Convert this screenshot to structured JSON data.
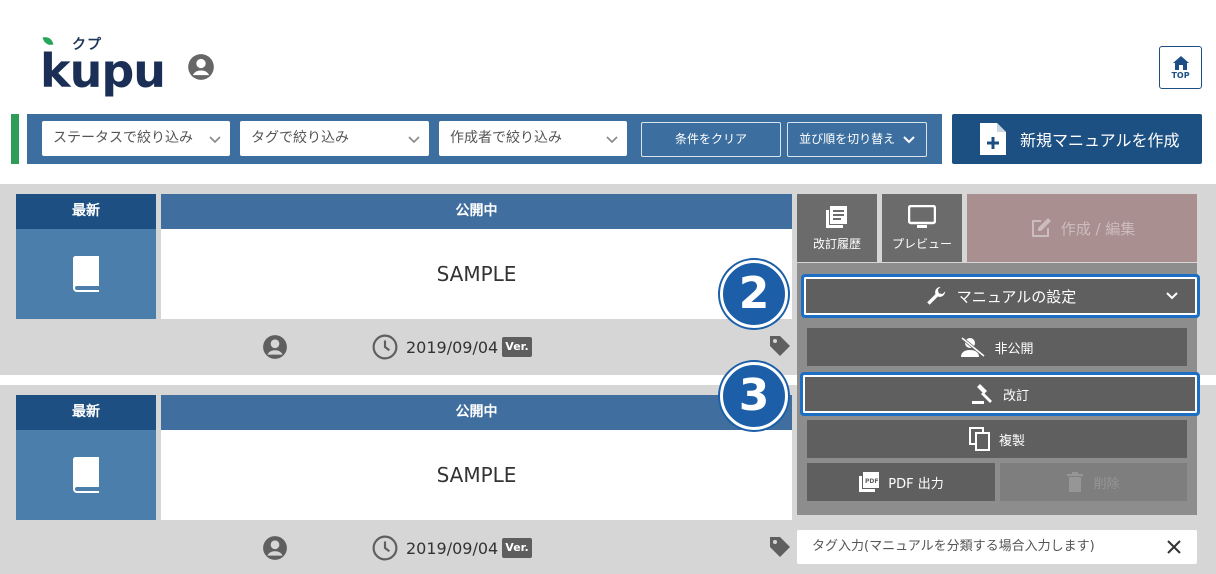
{
  "brand": {
    "name": "kupu",
    "kana": "クプ"
  },
  "header": {
    "top_button": "TOP"
  },
  "filters": {
    "status": "ステータスで絞り込み",
    "tag": "タグで絞り込み",
    "author": "作成者で絞り込み",
    "clear": "条件をクリア",
    "sort": "並び順を切り替え"
  },
  "new_button": "新規マニュアルを作成",
  "manuals": [
    {
      "badge": "最新",
      "status": "公開中",
      "title": "SAMPLE",
      "date": "2019/09/04",
      "ver": "Ver."
    },
    {
      "badge": "最新",
      "status": "公開中",
      "title": "SAMPLE",
      "date": "2019/09/04",
      "ver": "Ver."
    }
  ],
  "actions": {
    "history": "改訂履歴",
    "preview": "プレビュー",
    "edit": "作成 / 編集",
    "settings": "マニュアルの設定",
    "private": "非公開",
    "revise": "改訂",
    "copy": "複製",
    "pdf": "PDF 出力",
    "delete": "削除"
  },
  "tag_input_placeholder": "タグ入力(マニュアルを分類する場合入力します)",
  "callouts": {
    "two": "2",
    "three": "3"
  },
  "colors": {
    "primary": "#1c4f82",
    "accent_green": "#2e9d57",
    "highlight": "#1c6fc4"
  }
}
